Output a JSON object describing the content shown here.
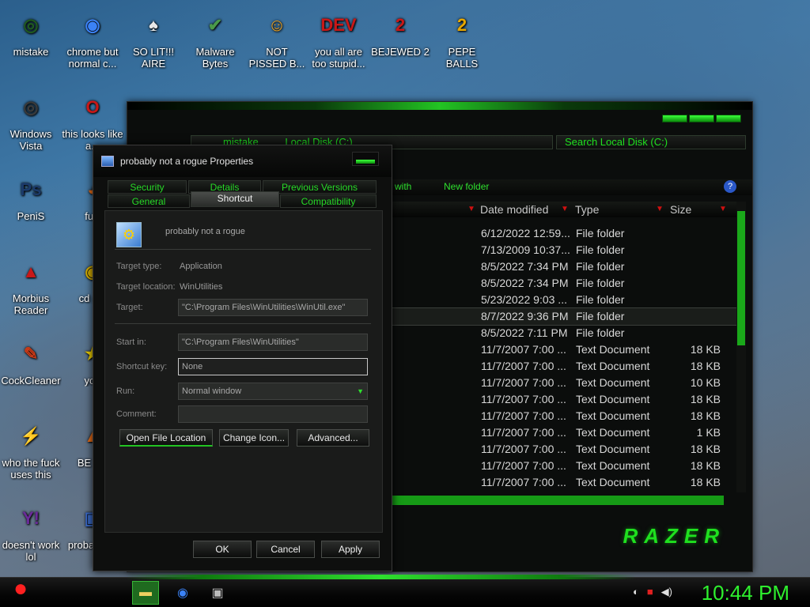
{
  "desktop": {
    "icons": [
      {
        "label": "mistake",
        "glyph": "◎",
        "color": "#1f5a1f"
      },
      {
        "label": "chrome but normal c...",
        "glyph": "◉",
        "color": "#3b82f6"
      },
      {
        "label": "SO LIT!!! AIRE",
        "glyph": "♠",
        "color": "#e8e8e8"
      },
      {
        "label": "Malware Bytes",
        "glyph": "✔",
        "color": "#4a9a4a"
      },
      {
        "label": "NOT PISSED B...",
        "glyph": "☺",
        "color": "#f2a21a"
      },
      {
        "label": "you all are too stupid...",
        "glyph": "DEV",
        "color": "#c81818"
      },
      {
        "label": "BEJEWED 2",
        "glyph": "2",
        "color": "#c81818"
      },
      {
        "label": "PEPE BALLS",
        "glyph": "2",
        "color": "#e8a800"
      },
      {
        "label": "Windows Vista",
        "glyph": "◎",
        "color": "#3a3a3a"
      },
      {
        "label": "this looks like a...",
        "glyph": "O",
        "color": "#c81818"
      },
      {
        "label": "PeniS",
        "glyph": "Ps",
        "color": "#1b3a6a"
      },
      {
        "label": "furr",
        "glyph": "◕",
        "color": "#f07018"
      },
      {
        "label": "Morbius Reader",
        "glyph": "▲",
        "color": "#c81818"
      },
      {
        "label": "cd gol",
        "glyph": "◉",
        "color": "#d8b000"
      },
      {
        "label": "CockCleaner",
        "glyph": "✎",
        "color": "#c83a18"
      },
      {
        "label": "you",
        "glyph": "★",
        "color": "#f0d000"
      },
      {
        "label": "who the fuck uses this",
        "glyph": "⚡",
        "color": "#e05010"
      },
      {
        "label": "BE BE",
        "glyph": "▲",
        "color": "#f07018"
      },
      {
        "label": "doesn't work lol",
        "glyph": "Y!",
        "color": "#6a2a9a"
      },
      {
        "label": "probal a ro",
        "glyph": "▣",
        "color": "#3a6ac8"
      }
    ]
  },
  "explorer": {
    "address_crumbs": [
      "mistake",
      "Local Disk (C:)"
    ],
    "search_placeholder": "Search Local Disk (C:)",
    "toolbar": {
      "open_with": "with",
      "new_folder": "New folder"
    },
    "columns": {
      "date": "Date modified",
      "type": "Type",
      "size": "Size"
    },
    "rows": [
      {
        "date": "6/12/2022 12:59...",
        "type": "File folder",
        "size": ""
      },
      {
        "date": "7/13/2009 10:37...",
        "type": "File folder",
        "size": ""
      },
      {
        "date": "8/5/2022 7:34 PM",
        "type": "File folder",
        "size": ""
      },
      {
        "date": "8/5/2022 7:34 PM",
        "type": "File folder",
        "size": ""
      },
      {
        "date": "5/23/2022 9:03 ...",
        "type": "File folder",
        "size": ""
      },
      {
        "date": "8/7/2022 9:36 PM",
        "type": "File folder",
        "size": ""
      },
      {
        "date": "8/5/2022 7:11 PM",
        "type": "File folder",
        "size": ""
      },
      {
        "date": "11/7/2007 7:00 ...",
        "type": "Text Document",
        "size": "18 KB"
      },
      {
        "date": "11/7/2007 7:00 ...",
        "type": "Text Document",
        "size": "18 KB"
      },
      {
        "date": "11/7/2007 7:00 ...",
        "type": "Text Document",
        "size": "10 KB"
      },
      {
        "date": "11/7/2007 7:00 ...",
        "type": "Text Document",
        "size": "18 KB"
      },
      {
        "date": "11/7/2007 7:00 ...",
        "type": "Text Document",
        "size": "18 KB"
      },
      {
        "date": "11/7/2007 7:00 ...",
        "type": "Text Document",
        "size": "1 KB"
      },
      {
        "date": "11/7/2007 7:00 ...",
        "type": "Text Document",
        "size": "18 KB"
      },
      {
        "date": "11/7/2007 7:00 ...",
        "type": "Text Document",
        "size": "18 KB"
      },
      {
        "date": "11/7/2007 7:00 ...",
        "type": "Text Document",
        "size": "18 KB"
      }
    ],
    "selected_row": 5,
    "brand_logo": "RAZER",
    "accent": "#1fe01f"
  },
  "dialog": {
    "title": "probably not a rogue Properties",
    "tabs_row1": [
      "Security",
      "Details",
      "Previous Versions"
    ],
    "tabs_row2": [
      "General",
      "Shortcut",
      "Compatibility"
    ],
    "active_tab": "Shortcut",
    "shortcut_name": "probably not a rogue",
    "target_type_label": "Target type:",
    "target_type": "Application",
    "target_location_label": "Target location:",
    "target_location": "WinUtilities",
    "target_label": "Target:",
    "target": "\"C:\\Program Files\\WinUtilities\\WinUtil.exe\"",
    "start_in_label": "Start in:",
    "start_in": "\"C:\\Program Files\\WinUtilities\"",
    "shortcut_key_label": "Shortcut key:",
    "shortcut_key": "None",
    "run_label": "Run:",
    "run": "Normal window",
    "comment_label": "Comment:",
    "comment": "",
    "open_file_location": "Open File Location",
    "change_icon": "Change Icon...",
    "advanced": "Advanced...",
    "ok": "OK",
    "cancel": "Cancel",
    "apply": "Apply"
  },
  "taskbar": {
    "clock": "10:44 PM",
    "tray_icons": [
      "network-icon",
      "flag-icon",
      "volume-icon"
    ]
  }
}
